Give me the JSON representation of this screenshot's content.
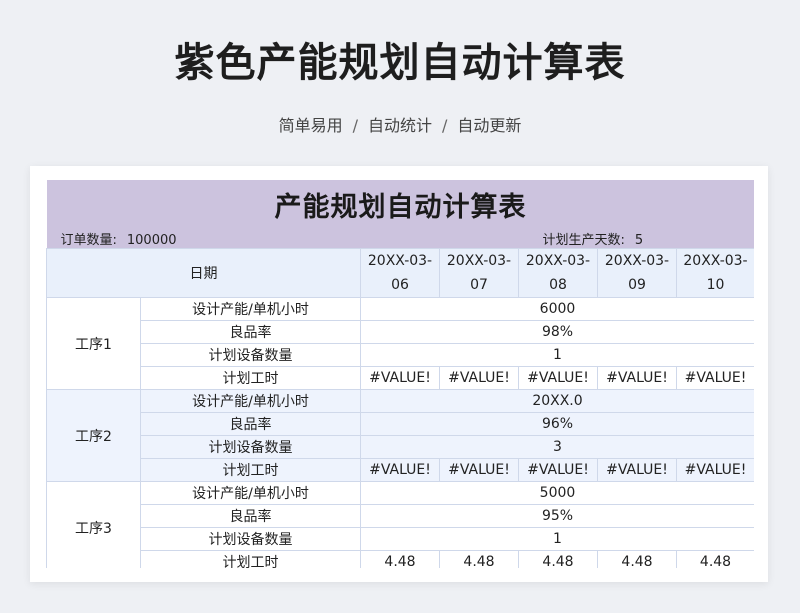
{
  "header": {
    "title": "紫色产能规划自动计算表",
    "subtitle_items": [
      "简单易用",
      "自动统计",
      "自动更新"
    ],
    "separator": "/"
  },
  "sheet": {
    "title": "产能规划自动计算表",
    "order_label": "订单数量:",
    "order_value": "100000",
    "plan_days_label": "计划生产天数:",
    "plan_days_value": "5",
    "date_label": "日期",
    "dates": [
      [
        "20XX-03-",
        "06"
      ],
      [
        "20XX-03-",
        "07"
      ],
      [
        "20XX-03-",
        "08"
      ],
      [
        "20XX-03-",
        "09"
      ],
      [
        "20XX-03-",
        "10"
      ]
    ],
    "row_labels": [
      "设计产能/单机小时",
      "良品率",
      "计划设备数量",
      "计划工时"
    ],
    "processes": [
      {
        "name": "工序1",
        "capacity": "6000",
        "yield": "98%",
        "equipment": "1",
        "hours": [
          "#VALUE!",
          "#VALUE!",
          "#VALUE!",
          "#VALUE!",
          "#VALUE!"
        ]
      },
      {
        "name": "工序2",
        "capacity": "20XX.0",
        "yield": "96%",
        "equipment": "3",
        "hours": [
          "#VALUE!",
          "#VALUE!",
          "#VALUE!",
          "#VALUE!",
          "#VALUE!"
        ]
      },
      {
        "name": "工序3",
        "capacity": "5000",
        "yield": "95%",
        "equipment": "1",
        "hours": [
          "4.48",
          "4.48",
          "4.48",
          "4.48",
          "4.48"
        ]
      }
    ]
  },
  "colors": {
    "title_band": "#ccc3de",
    "header_band": "#e9f0fb",
    "alt_block": "#eef3fd",
    "grid": "#cfd8ea",
    "page_bg": "#eef0f4"
  }
}
